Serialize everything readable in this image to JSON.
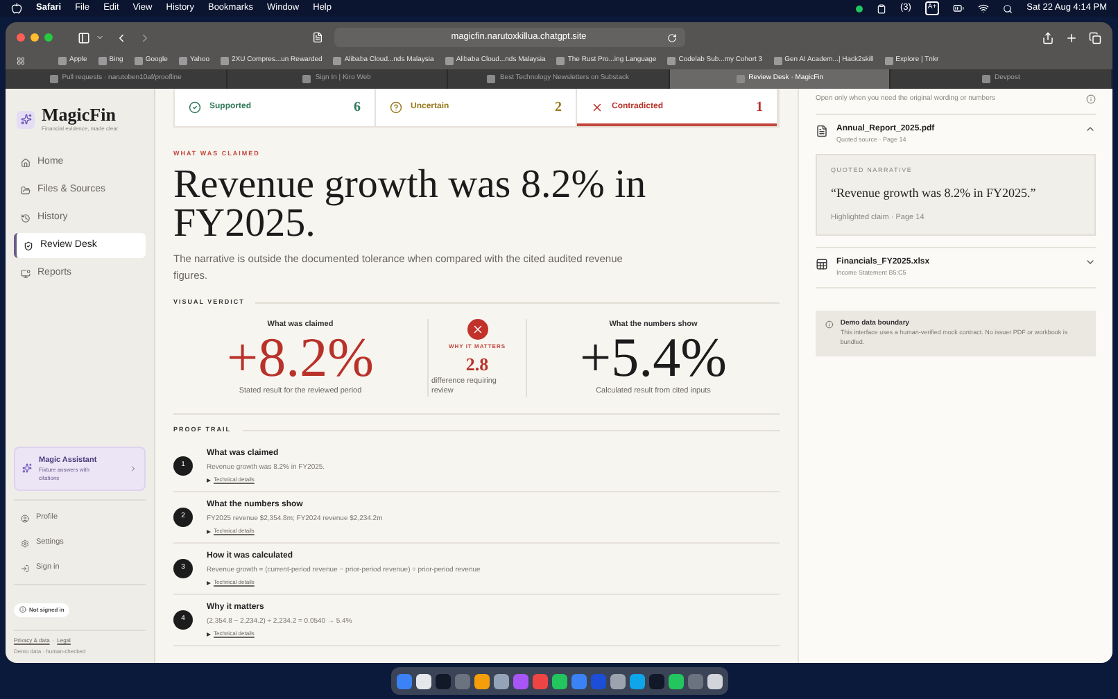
{
  "menu_bar": {
    "app": "Safari",
    "items": [
      "File",
      "Edit",
      "View",
      "History",
      "Bookmarks",
      "Window",
      "Help"
    ],
    "badge": "(3)",
    "input_mode": "A+",
    "clock": "Sat 22 Aug 4:14 PM"
  },
  "browser": {
    "address": "magicfin.narutoxkillua.chatgpt.site",
    "bookmarks": [
      "Apple",
      "Bing",
      "Google",
      "Yahoo",
      "2XU Compres...un Rewarded",
      "Alibaba Cloud...nds Malaysia",
      "Alibaba Cloud...nds Malaysia",
      "The Rust Pro...ing Language",
      "Codelab Sub...my Cohort 3",
      "Gen AI Academ...| Hack2skill",
      "Explore | Tnkr"
    ],
    "tabs": [
      {
        "label": "Pull requests · narutoben10af/proofline",
        "selected": false
      },
      {
        "label": "Sign In | Kiro Web",
        "selected": false
      },
      {
        "label": "Best Technology Newsletters on Substack",
        "selected": false
      },
      {
        "label": "Review Desk · MagicFin",
        "selected": true
      },
      {
        "label": "Devpost",
        "selected": false
      }
    ]
  },
  "sidebar": {
    "brand": "MagicFin",
    "tagline": "Financial evidence, made clear",
    "nav": [
      {
        "kind": "home",
        "label": "Home",
        "selected": false
      },
      {
        "kind": "files",
        "label": "Files & Sources",
        "selected": false
      },
      {
        "kind": "history",
        "label": "History",
        "selected": false
      },
      {
        "kind": "review",
        "label": "Review Desk",
        "selected": true
      },
      {
        "kind": "reports",
        "label": "Reports",
        "selected": false
      }
    ],
    "assistant": {
      "title": "Magic Assistant",
      "subtitle": "Fixture answers with citations"
    },
    "account": [
      {
        "kind": "profile",
        "label": "Profile"
      },
      {
        "kind": "settings",
        "label": "Settings"
      },
      {
        "kind": "signin",
        "label": "Sign in"
      }
    ],
    "status": "Not signed in",
    "links": [
      "Privacy & data",
      "Legal"
    ],
    "separator": "·",
    "note": "Demo data · human-checked"
  },
  "main": {
    "verdict_tabs": [
      {
        "kind": "supported",
        "label": "Supported",
        "count": "6",
        "selected": false
      },
      {
        "kind": "uncertain",
        "label": "Uncertain",
        "count": "2",
        "selected": false
      },
      {
        "kind": "contradicted",
        "label": "Contradicted",
        "count": "1",
        "selected": true
      }
    ],
    "eyebrow": "WHAT WAS CLAIMED",
    "headline": "Revenue growth was 8.2% in FY2025.",
    "summary": "The narrative is outside the documented tolerance when compared with the cited audited revenue figures.",
    "visual_verdict": {
      "label": "VISUAL VERDICT",
      "claimed": {
        "heading": "What was claimed",
        "value": "+8.2%",
        "caption": "Stated result for the reviewed period"
      },
      "matters": {
        "label": "WHY IT MATTERS",
        "value": "2.8",
        "caption": "difference requiring review"
      },
      "actual": {
        "heading": "What the numbers show",
        "value": "+5.4%",
        "caption": "Calculated result from cited inputs"
      }
    },
    "proof_trail": {
      "label": "PROOF TRAIL",
      "steps": [
        {
          "number": "1",
          "title": "What was claimed",
          "text": "Revenue growth was 8.2% in FY2025.",
          "details": "Technical details"
        },
        {
          "number": "2",
          "title": "What the numbers show",
          "text": "FY2025 revenue $2,354.8m; FY2024 revenue $2,234.2m",
          "details": "Technical details"
        },
        {
          "number": "3",
          "title": "How it was calculated",
          "text": "Revenue growth = (current-period revenue − prior-period revenue) ÷ prior-period revenue",
          "details": "Technical details"
        },
        {
          "number": "4",
          "title": "Why it matters",
          "text": "(2,354.8 − 2,234.2) ÷ 2,234.2 = 0.0540 → 5.4%",
          "details": "Technical details"
        }
      ]
    }
  },
  "sources_panel": {
    "hint": "Open only when you need the original wording or numbers",
    "sources": [
      {
        "kind": "pdf",
        "name": "Annual_Report_2025.pdf",
        "meta": "Quoted source · Page 14",
        "expanded": true,
        "quote": {
          "label": "QUOTED NARRATIVE",
          "text": "“Revenue growth was 8.2% in FY2025.”",
          "caption": "Highlighted claim · Page 14"
        }
      },
      {
        "kind": "sheet",
        "name": "Financials_FY2025.xlsx",
        "meta": "Income Statement B5:C5",
        "expanded": false
      }
    ],
    "notice": {
      "title": "Demo data boundary",
      "text": "This interface uses a human-verified mock contract. No issuer PDF or workbook is bundled."
    }
  }
}
